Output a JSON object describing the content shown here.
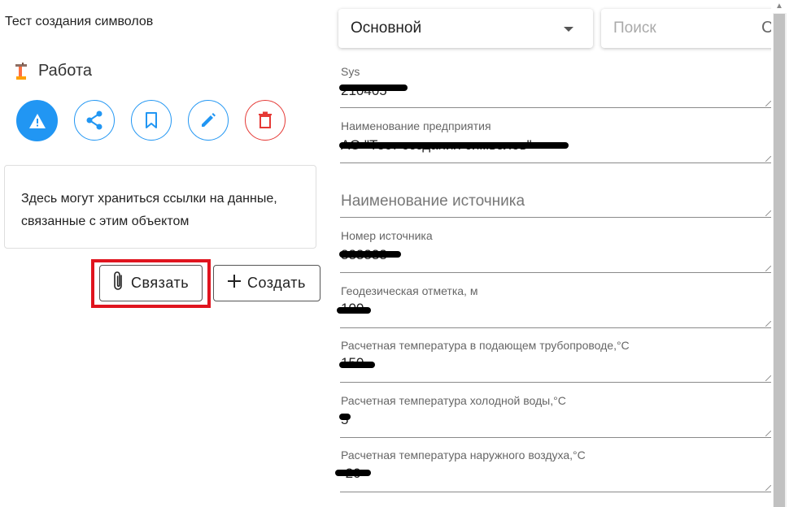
{
  "left": {
    "app_title": "Тест создания символов",
    "object": {
      "icon": "crane-icon",
      "name": "Работа"
    },
    "actions": [
      {
        "name": "warning-button",
        "icon": "warning-icon"
      },
      {
        "name": "share-button",
        "icon": "share-icon"
      },
      {
        "name": "bookmark-button",
        "icon": "bookmark-icon"
      },
      {
        "name": "edit-button",
        "icon": "pencil-icon"
      },
      {
        "name": "delete-button",
        "icon": "trash-icon"
      }
    ],
    "links_text": "Здесь могут храниться ссылки на данные, связанные с этим объектом",
    "link_button": "Связать",
    "create_button": "Создать"
  },
  "right": {
    "mode_select": "Основной",
    "search_placeholder": "Поиск",
    "search_glyph": "C",
    "fields": [
      {
        "label": "Sys",
        "value": "210405"
      },
      {
        "label": "Наименование предприятия",
        "value": "АО \"Тест создания символов\""
      },
      {
        "label": "Наименование источника",
        "value": ""
      },
      {
        "label": "Номер источника",
        "value": "333333"
      },
      {
        "label": "Геодезическая отметка, м",
        "value": "100"
      },
      {
        "label": "Расчетная температура в подающем трубопроводе,°C",
        "value": "150"
      },
      {
        "label": "Расчетная температура холодной воды,°C",
        "value": "5"
      },
      {
        "label": "Расчетная температура наружного воздуха,°C",
        "value": "-20"
      }
    ]
  },
  "colors": {
    "accent": "#2196f3",
    "danger": "#e53935",
    "highlight": "#e0141e"
  }
}
